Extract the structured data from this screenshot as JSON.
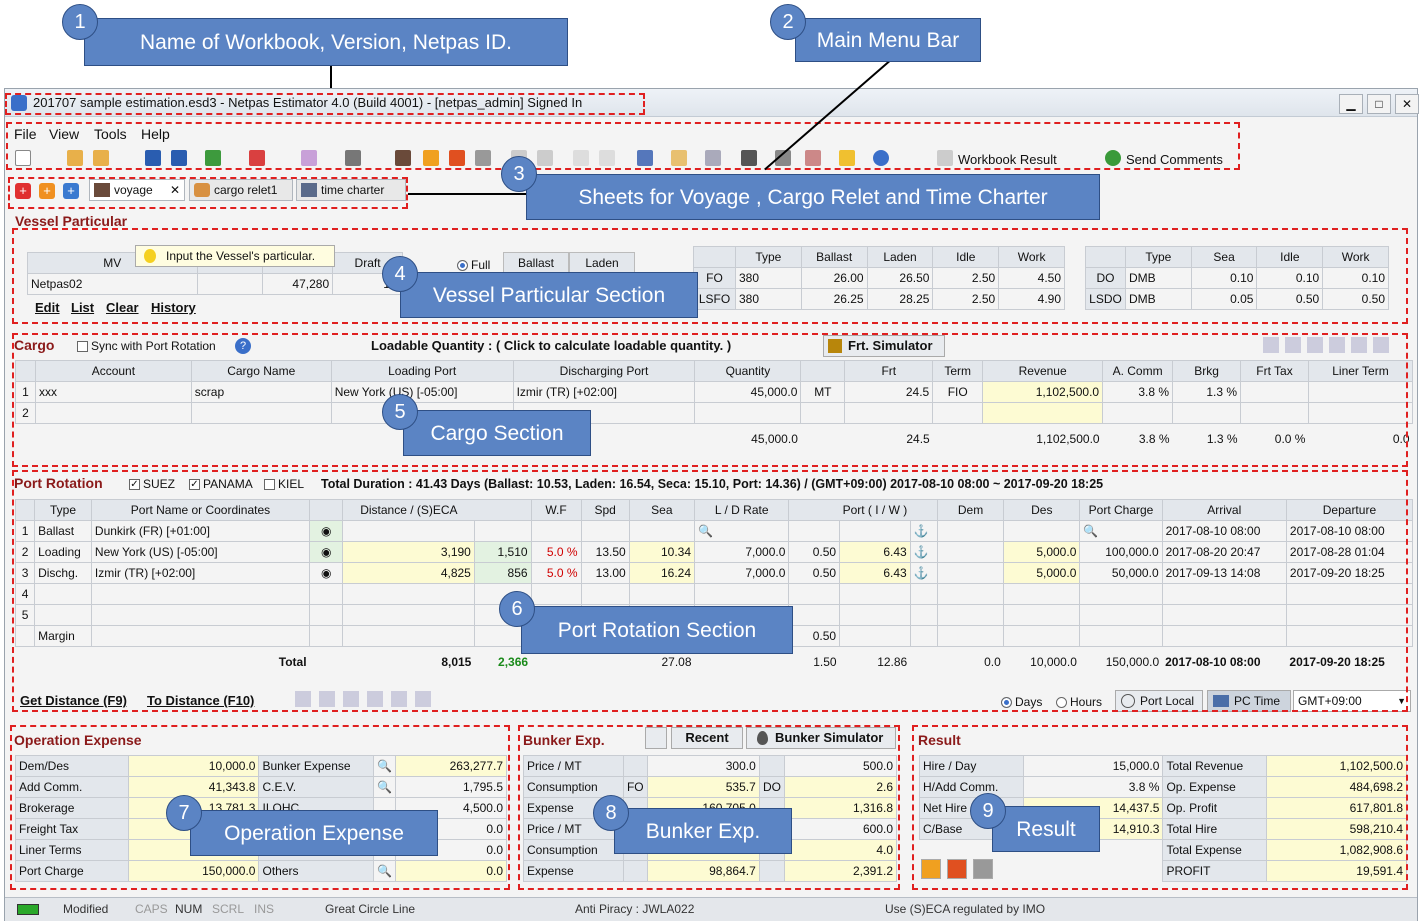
{
  "window": {
    "title": "201707 sample estimation.esd3 - Netpas Estimator 4.0 (Build 4001) - [netpas_admin] Signed In",
    "min": "▁",
    "max": "□",
    "close": "✕"
  },
  "menu": [
    "File",
    "View",
    "Tools",
    "Help"
  ],
  "toolbar": {
    "workbook_result": "Workbook Result",
    "send_comments": "Send Comments"
  },
  "tabs": [
    "voyage",
    "cargo relet1",
    "time charter"
  ],
  "vessel": {
    "title": "Vessel Particular",
    "tooltip": "Input the Vessel's particular.",
    "mv_header": "MV",
    "draft_header": "Draft",
    "name": "Netpas02",
    "dwt": "47,280",
    "draft": "11.",
    "links": [
      "Edit",
      "List",
      "Clear",
      "History"
    ],
    "load_mode": {
      "full": "Full",
      "ballast": "Ballast",
      "laden": "Laden"
    },
    "fuel_headers": [
      "Type",
      "Ballast",
      "Laden",
      "Idle",
      "Work"
    ],
    "fuel_rows": [
      [
        "FO",
        "380",
        "26.00",
        "26.50",
        "2.50",
        "4.50"
      ],
      [
        "LSFO",
        "380",
        "26.25",
        "28.25",
        "2.50",
        "4.90"
      ]
    ],
    "diesel_headers": [
      "Type",
      "Sea",
      "Idle",
      "Work"
    ],
    "diesel_rows": [
      [
        "DO",
        "DMB",
        "0.10",
        "0.10",
        "0.10"
      ],
      [
        "LSDO",
        "DMB",
        "0.05",
        "0.50",
        "0.50"
      ]
    ]
  },
  "cargo": {
    "title": "Cargo",
    "sync": "Sync with Port Rotation",
    "loadable": "Loadable Quantity :  ( Click to calculate loadable quantity. )",
    "simulator": "Frt. Simulator",
    "headers": [
      "Account",
      "Cargo Name",
      "Loading Port",
      "Discharging Port",
      "Quantity",
      "",
      "Frt",
      "Term",
      "Revenue",
      "A. Comm",
      "Brkg",
      "Frt Tax",
      "Liner Term"
    ],
    "rows": [
      [
        "1",
        "xxx",
        "scrap",
        "New York (US) [-05:00]",
        "Izmir (TR) [+02:00]",
        "45,000.0",
        "MT",
        "24.5",
        "FIO",
        "1,102,500.0",
        "3.8 %",
        "1.3 %",
        "",
        ""
      ],
      [
        "2",
        "",
        "",
        "",
        "",
        "",
        "",
        "",
        "",
        "",
        "",
        "",
        "",
        ""
      ]
    ],
    "totals": [
      "45,000.0",
      "24.5",
      "1,102,500.0",
      "3.8 %",
      "1.3 %",
      "0.0 %",
      "0.0"
    ]
  },
  "port": {
    "title": "Port Rotation",
    "canals": [
      "SUEZ",
      "PANAMA",
      "KIEL"
    ],
    "summary": "Total Duration : 41.43 Days (Ballast: 10.53, Laden: 16.54, Seca: 15.10, Port: 14.36) / (GMT+09:00) 2017-08-10 08:00 ~ 2017-09-20 18:25",
    "headers": [
      "Type",
      "Port Name or Coordinates",
      "Distance / (S)ECA",
      "W.F",
      "Spd",
      "Sea",
      "L / D Rate",
      "Port ( I / W )",
      "Dem",
      "Des",
      "Port Charge",
      "Arrival",
      "Departure"
    ],
    "rows": [
      [
        "1",
        "Ballast",
        "Dunkirk (FR) [+01:00]",
        "",
        "",
        "",
        "",
        "",
        "",
        "",
        "",
        "",
        "",
        "",
        "",
        "2017-08-10 08:00",
        "2017-08-10 08:00"
      ],
      [
        "2",
        "Loading",
        "New York (US) [-05:00]",
        "3,190",
        "1,510",
        "5.0 %",
        "13.50",
        "10.34",
        "7,000.0",
        "0.50",
        "6.43",
        "",
        "5,000.0",
        "100,000.0",
        "2017-08-20 20:47",
        "2017-08-28 01:04"
      ],
      [
        "3",
        "Dischg.",
        "Izmir (TR) [+02:00]",
        "4,825",
        "856",
        "5.0 %",
        "13.00",
        "16.24",
        "7,000.0",
        "0.50",
        "6.43",
        "",
        "5,000.0",
        "50,000.0",
        "2017-09-13 14:08",
        "2017-09-20 18:25"
      ],
      [
        "4"
      ],
      [
        "5"
      ]
    ],
    "margin_label": "Margin",
    "margin_val": "0.50",
    "total_label": "Total",
    "totals": [
      "8,015",
      "2,366",
      "27.08",
      "1.50",
      "12.86",
      "0.0",
      "10,000.0",
      "150,000.0",
      "2017-08-10 08:00",
      "2017-09-20 18:25"
    ],
    "get_distance": "Get Distance (F9)",
    "to_distance": "To Distance (F10)",
    "days": "Days",
    "hours": "Hours",
    "port_local": "Port Local",
    "pc_time": "PC Time",
    "gmt": "GMT+09:00"
  },
  "opex": {
    "title": "Operation Expense",
    "rows": [
      [
        "Dem/Des",
        "10,000.0",
        "Bunker Expense",
        "263,277.7"
      ],
      [
        "Add Comm.",
        "41,343.8",
        "C.E.V.",
        "1,795.5"
      ],
      [
        "Brokerage",
        "13,781.3",
        "ILOHC",
        "4,500.0"
      ],
      [
        "Freight Tax",
        "",
        "",
        "0.0"
      ],
      [
        "Liner Terms",
        "",
        "",
        "0.0"
      ],
      [
        "Port Charge",
        "150,000.0",
        "Others",
        "0.0"
      ]
    ]
  },
  "bunker": {
    "title": "Bunker Exp.",
    "recent": "Recent",
    "simulator": "Bunker Simulator",
    "rows": [
      [
        "Price / MT",
        "",
        "300.0",
        "",
        "500.0"
      ],
      [
        "Consumption",
        "FO",
        "535.7",
        "DO",
        "2.6"
      ],
      [
        "Expense",
        "",
        "160,705.0",
        "",
        "1,316.8"
      ],
      [
        "Price / MT",
        "",
        "",
        "",
        "600.0"
      ],
      [
        "Consumption",
        "",
        "",
        "",
        "4.0"
      ],
      [
        "Expense",
        "",
        "98,864.7",
        "",
        "2,391.2"
      ]
    ],
    "fo2": "FO",
    "do2": "DO"
  },
  "result": {
    "title": "Result",
    "rows": [
      [
        "Hire / Day",
        "15,000.0",
        "Total Revenue",
        "1,102,500.0"
      ],
      [
        "H/Add Comm.",
        "3.8 %",
        "Op. Expense",
        "484,698.2"
      ],
      [
        "Net Hire",
        "14,437.5",
        "Op. Profit",
        "617,801.8"
      ],
      [
        "C/Base",
        "14,910.3",
        "Total Hire",
        "598,210.4"
      ],
      [
        "",
        "",
        "Total Expense",
        "1,082,908.6"
      ],
      [
        "",
        "",
        "PROFIT",
        "19,591.4"
      ]
    ]
  },
  "status": {
    "modified": "Modified",
    "caps": "CAPS",
    "num": "NUM",
    "scrl": "SCRL",
    "ins": "INS",
    "circle": "Great Circle Line",
    "anti": "Anti Piracy : JWLA022",
    "seca": "Use (S)ECA regulated by IMO"
  },
  "callouts": [
    {
      "n": "1",
      "text": "Name of Workbook, Version, Netpas ID."
    },
    {
      "n": "2",
      "text": "Main Menu Bar"
    },
    {
      "n": "3",
      "text": "Sheets for Voyage , Cargo Relet and Time Charter"
    },
    {
      "n": "4",
      "text": "Vessel Particular Section"
    },
    {
      "n": "5",
      "text": "Cargo Section"
    },
    {
      "n": "6",
      "text": "Port Rotation Section"
    },
    {
      "n": "7",
      "text": "Operation Expense"
    },
    {
      "n": "8",
      "text": "Bunker Exp."
    },
    {
      "n": "9",
      "text": "Result"
    }
  ]
}
